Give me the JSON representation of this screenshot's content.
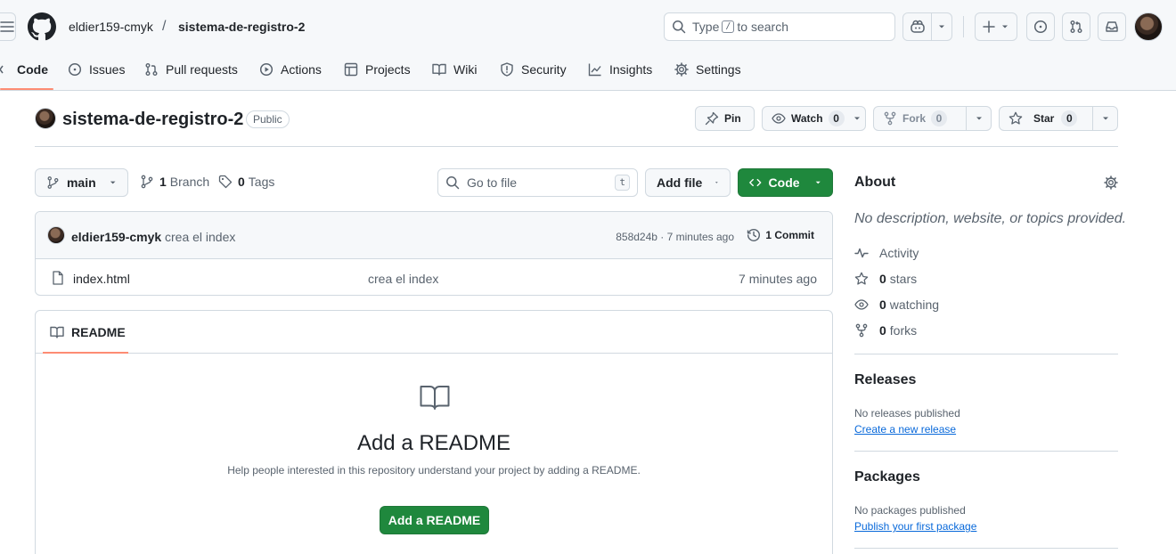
{
  "header": {
    "owner": "eldier159-cmyk",
    "separator": "/",
    "repo": "sistema-de-registro-2",
    "search": {
      "prefix": "Type",
      "key": "/",
      "suffix": "to search"
    },
    "icons": [
      "menu-icon",
      "github-logo-icon",
      "copilot-icon",
      "plus-icon",
      "issue-opened-icon",
      "git-pull-request-icon",
      "inbox-icon"
    ]
  },
  "nav": {
    "tabs": [
      {
        "label": "Code",
        "icon": "code-icon"
      },
      {
        "label": "Issues",
        "icon": "issue-opened-icon"
      },
      {
        "label": "Pull requests",
        "icon": "git-pull-request-icon"
      },
      {
        "label": "Actions",
        "icon": "play-icon"
      },
      {
        "label": "Projects",
        "icon": "table-icon"
      },
      {
        "label": "Wiki",
        "icon": "book-icon"
      },
      {
        "label": "Security",
        "icon": "shield-icon"
      },
      {
        "label": "Insights",
        "icon": "graph-icon"
      },
      {
        "label": "Settings",
        "icon": "gear-icon"
      }
    ],
    "active": "Code"
  },
  "repo": {
    "title": "sistema-de-registro-2",
    "visibility": "Public",
    "pin_label": "Pin",
    "watch_label": "Watch",
    "watch_count": "0",
    "fork_label": "Fork",
    "fork_count": "0",
    "star_label": "Star",
    "star_count": "0"
  },
  "controls": {
    "branch": "main",
    "branches_count": "1",
    "branches_label": "Branch",
    "tags_count": "0",
    "tags_label": "Tags",
    "goto_placeholder": "Go to file",
    "goto_key": "t",
    "add_file": "Add file",
    "code": "Code"
  },
  "commit": {
    "author": "eldier159-cmyk",
    "message": "crea el index",
    "meta": "858d24b · 7 minutes ago",
    "count_label": "1 Commit"
  },
  "files": [
    {
      "name": "index.html",
      "message": "crea el index",
      "time": "7 minutes ago"
    }
  ],
  "readme": {
    "tab": "README",
    "title": "Add a README",
    "description": "Help people interested in this repository understand your project by adding a README.",
    "button": "Add a README"
  },
  "about": {
    "heading": "About",
    "description": "No description, website, or topics provided.",
    "items": [
      {
        "icon": "pulse-icon",
        "count": "",
        "label": "Activity"
      },
      {
        "icon": "star-icon",
        "count": "0",
        "label": "stars"
      },
      {
        "icon": "eye-icon",
        "count": "0",
        "label": "watching"
      },
      {
        "icon": "repo-forked-icon",
        "count": "0",
        "label": "forks"
      }
    ]
  },
  "releases": {
    "heading": "Releases",
    "text": "No releases published",
    "link": "Create a new release"
  },
  "packages": {
    "heading": "Packages",
    "text": "No packages published",
    "link": "Publish your first package"
  },
  "colors": {
    "accent_green": "#1f883d",
    "tab_underline": "#fd8c73",
    "link_blue": "#0969da",
    "border": "#d1d9e0",
    "muted": "#59636e"
  }
}
